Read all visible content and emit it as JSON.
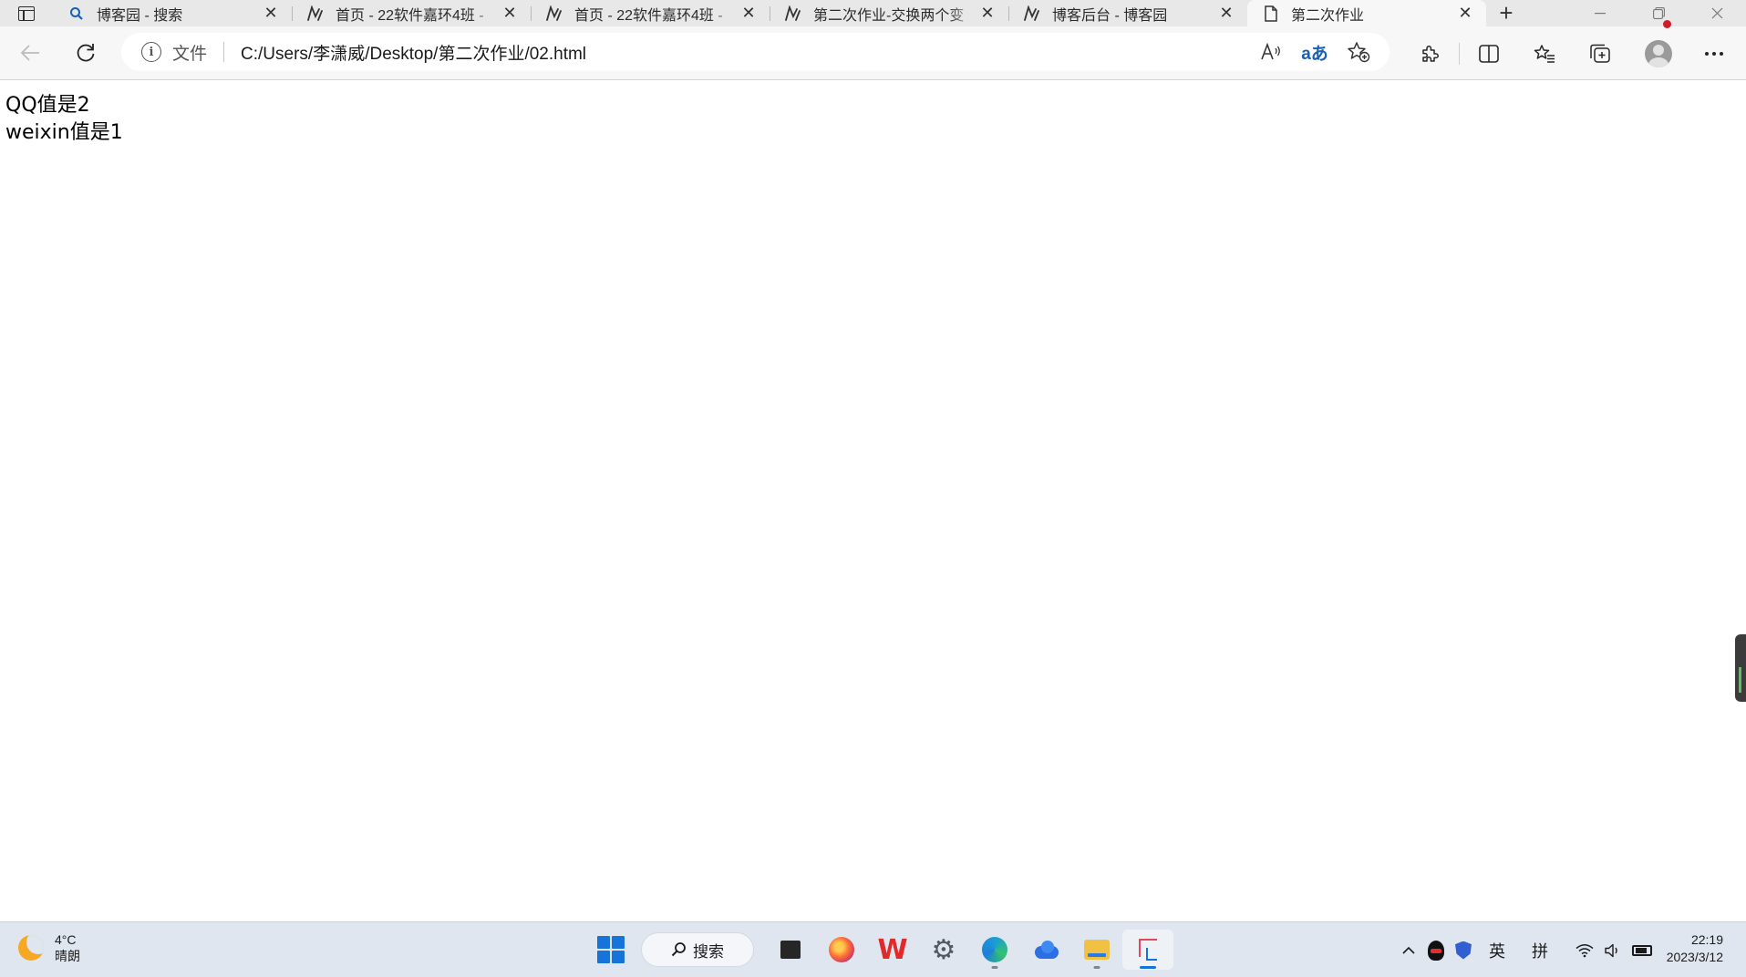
{
  "browser": {
    "tabs": [
      {
        "title": "博客园 - 搜索",
        "icon": "search-icon",
        "active": false
      },
      {
        "title": "首页 - 22软件嘉环4班 -",
        "icon": "cnblogs-icon",
        "active": false
      },
      {
        "title": "首页 - 22软件嘉环4班 -",
        "icon": "cnblogs-icon",
        "active": false
      },
      {
        "title": "第二次作业-交换两个变",
        "icon": "cnblogs-icon",
        "active": false
      },
      {
        "title": "博客后台 - 博客园",
        "icon": "cnblogs-icon",
        "active": false
      },
      {
        "title": "第二次作业",
        "icon": "page-icon",
        "active": true
      }
    ],
    "new_tab_glyph": "+",
    "address": {
      "origin_label": "文件",
      "url": "C:/Users/李潇威/Desktop/第二次作业/02.html",
      "translate_glyph": "aあ"
    }
  },
  "page": {
    "lines": [
      "QQ值是2",
      "weixin值是1"
    ]
  },
  "taskbar": {
    "weather": {
      "temperature": "4°C",
      "condition": "晴朗"
    },
    "search_label": "搜索",
    "tray": {
      "input_lang": "英",
      "input_mode": "拼"
    },
    "clock": {
      "time": "22:19",
      "date": "2023/3/12"
    }
  },
  "colors": {
    "accent": "#1673d9",
    "tabstrip_bg": "#e8e8e8",
    "toolbar_bg": "#f7f7f7",
    "taskbar_bg": "#dfe6ef"
  }
}
